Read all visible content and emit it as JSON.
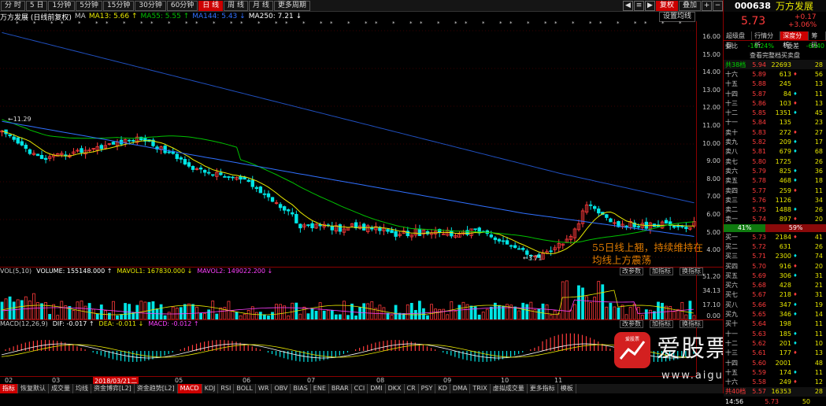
{
  "toolbar": {
    "periods": [
      "分 时",
      "5 日",
      "1分钟",
      "5分钟",
      "15分钟",
      "30分钟",
      "60分钟",
      "日 线",
      "周 线",
      "月 线",
      "更多周期"
    ],
    "active": "日 线",
    "adjust": "复权",
    "overlay": "叠加",
    "extra": [
      "◀",
      "≡",
      "▶"
    ]
  },
  "ma": {
    "title": "万方发展 (日线前复权)",
    "label": "MA",
    "ma13": "MA13: 5.66 ↑",
    "ma55": "MA55: 5.55 ↑",
    "ma144": "MA144: 5.43 ↓",
    "ma250": "MA250: 7.21 ↓",
    "setting": "设置均线"
  },
  "yaxis": [
    "16.00",
    "15.00",
    "14.00",
    "13.00",
    "12.00",
    "11.00",
    "10.00",
    "9.00",
    "8.00",
    "7.00",
    "6.00",
    "5.00",
    "4.00"
  ],
  "price_marks": {
    "high": "←11.29",
    "low": "←3.71"
  },
  "annotation": {
    "line1": "55日线上翘，持续维持在",
    "line2": "均线上方震荡"
  },
  "vol": {
    "label": "VOL(5,10)",
    "volume": "VOLUME: 155148.000 ↑",
    "mavol1": "MAVOL1: 167830.000 ↓",
    "mavol2": "MAVOL2: 149022.200 ↓",
    "buttons": [
      "改参数",
      "加指标",
      "换指标"
    ],
    "yticks": [
      "51.20",
      "34.13",
      "17.10",
      "0.00"
    ]
  },
  "macd": {
    "label": "MACD(12,26,9)",
    "dif": "DIF: -0.017 ↑",
    "dea": "DEA: -0.011 ↓",
    "macd": "MACD: -0.012 ↑",
    "buttons": [
      "改参数",
      "加指标",
      "换指标"
    ]
  },
  "xaxis": [
    "02",
    "03",
    "2018/03/21二",
    "05",
    "06",
    "07",
    "08",
    "09",
    "10",
    "11"
  ],
  "bottom": [
    "指标",
    "恢复默认",
    "成交量",
    "均线",
    "资金博弈[L2]",
    "资金趋势[L2]",
    "MACD",
    "KDJ",
    "RSI",
    "BOLL",
    "WR",
    "OBV",
    "BIAS",
    "ENE",
    "BRAR",
    "CCI",
    "DMI",
    "DKX",
    "CR",
    "PSY",
    "KD",
    "DMA",
    "TRIX",
    "虚拟成交量",
    "更多指标",
    "模板"
  ],
  "side": {
    "code": "000638",
    "name": "万方发展",
    "price": "5.73",
    "change": "+0.17",
    "pct": "+3.06%",
    "tabs": [
      "超级盘口",
      "行情分析",
      "深度分析",
      "筹码"
    ],
    "weibi": {
      "label": "委比",
      "value": "-16.24%",
      "label2": "委差",
      "value2": "-6340"
    },
    "full": "查看完整档买卖盘",
    "total": {
      "label": "共38档",
      "price": "5.94",
      "vol": "22693",
      "n": "28"
    },
    "asks": [
      {
        "l": "十六",
        "p": "5.89",
        "v": "613",
        "n": "56"
      },
      {
        "l": "十五",
        "p": "5.88",
        "v": "245",
        "n": "13"
      },
      {
        "l": "十四",
        "p": "5.87",
        "v": "84",
        "n": "11"
      },
      {
        "l": "十三",
        "p": "5.86",
        "v": "103",
        "n": "13"
      },
      {
        "l": "十二",
        "p": "5.85",
        "v": "1351",
        "n": "45"
      },
      {
        "l": "十一",
        "p": "5.84",
        "v": "135",
        "n": "23"
      },
      {
        "l": "卖十",
        "p": "5.83",
        "v": "272",
        "n": "27"
      },
      {
        "l": "卖九",
        "p": "5.82",
        "v": "209",
        "n": "17"
      },
      {
        "l": "卖八",
        "p": "5.81",
        "v": "679",
        "n": "68"
      },
      {
        "l": "卖七",
        "p": "5.80",
        "v": "1725",
        "n": "26"
      },
      {
        "l": "卖六",
        "p": "5.79",
        "v": "825",
        "n": "36"
      },
      {
        "l": "卖五",
        "p": "5.78",
        "v": "468",
        "n": "18"
      },
      {
        "l": "卖四",
        "p": "5.77",
        "v": "259",
        "n": "11"
      },
      {
        "l": "卖三",
        "p": "5.76",
        "v": "1126",
        "n": "34"
      },
      {
        "l": "卖二",
        "p": "5.75",
        "v": "1488",
        "n": "26"
      },
      {
        "l": "卖一",
        "p": "5.74",
        "v": "897",
        "n": "20"
      }
    ],
    "ratio": {
      "left": "41%",
      "right": "59%"
    },
    "bids": [
      {
        "l": "买一",
        "p": "5.73",
        "v": "2184",
        "n": "41"
      },
      {
        "l": "买二",
        "p": "5.72",
        "v": "631",
        "n": "26"
      },
      {
        "l": "买三",
        "p": "5.71",
        "v": "2300",
        "n": "74"
      },
      {
        "l": "买四",
        "p": "5.70",
        "v": "916",
        "n": "20"
      },
      {
        "l": "买五",
        "p": "5.69",
        "v": "306",
        "n": "31"
      },
      {
        "l": "买六",
        "p": "5.68",
        "v": "428",
        "n": "21"
      },
      {
        "l": "买七",
        "p": "5.67",
        "v": "218",
        "n": "31"
      },
      {
        "l": "买八",
        "p": "5.66",
        "v": "347",
        "n": "19"
      },
      {
        "l": "买九",
        "p": "5.65",
        "v": "346",
        "n": "14"
      },
      {
        "l": "买十",
        "p": "5.64",
        "v": "198",
        "n": "11"
      },
      {
        "l": "十一",
        "p": "5.63",
        "v": "185",
        "n": "11"
      },
      {
        "l": "十二",
        "p": "5.62",
        "v": "201",
        "n": "10"
      },
      {
        "l": "十三",
        "p": "5.61",
        "v": "177",
        "n": "13"
      },
      {
        "l": "十四",
        "p": "5.60",
        "v": "2001",
        "n": "48"
      },
      {
        "l": "十五",
        "p": "5.59",
        "v": "174",
        "n": "11"
      },
      {
        "l": "十六",
        "p": "5.58",
        "v": "249",
        "n": "12"
      }
    ],
    "total_bid": {
      "label": "共40档",
      "price": "5.57",
      "vol": "16353",
      "n": "28"
    },
    "time": {
      "t": "14:56",
      "p": "5.73",
      "n": "50"
    }
  },
  "watermark": {
    "brand": "爱股票APP",
    "url": "www.aigupiao.com",
    "badge": "爱股票"
  },
  "colors": {
    "up": "#ff3b3b",
    "down": "#00e5e5",
    "ma13": "#e8e800",
    "ma55": "#00c000",
    "ma144": "#3070ff",
    "ma250": "#2050c0",
    "accent": "#c00000"
  }
}
